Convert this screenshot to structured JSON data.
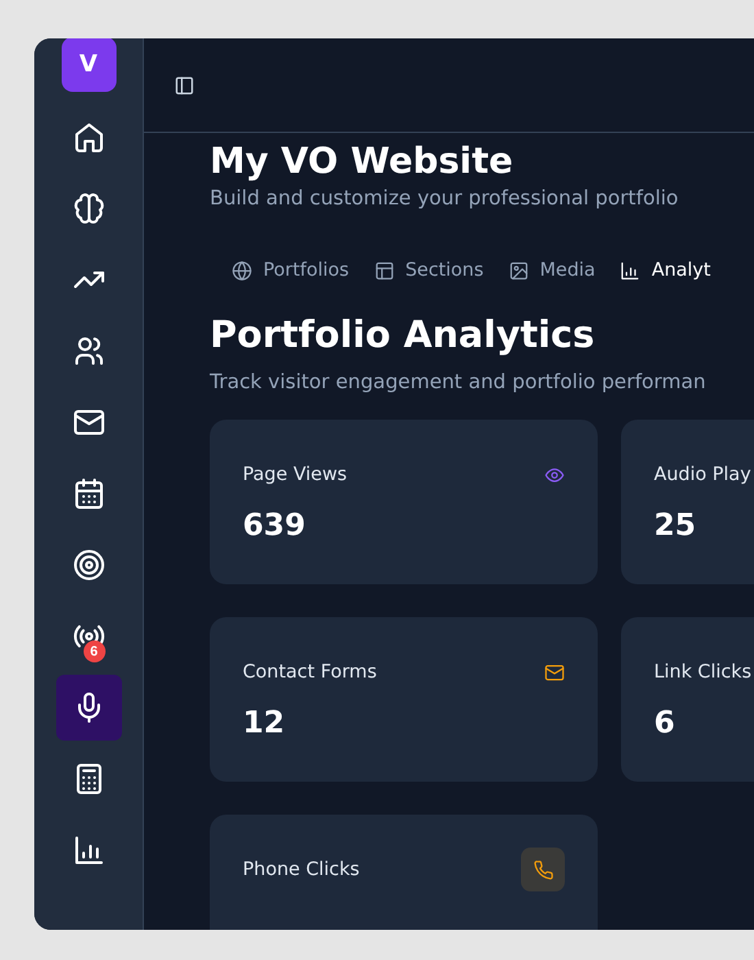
{
  "logo": {
    "letter": "V"
  },
  "sidebar": {
    "items": [
      {
        "selected": false
      },
      {
        "selected": false
      },
      {
        "selected": false
      },
      {
        "selected": false
      },
      {
        "selected": false
      },
      {
        "selected": false
      },
      {
        "selected": false
      },
      {
        "selected": false,
        "badge": "6"
      },
      {
        "selected": true
      },
      {
        "selected": false
      },
      {
        "selected": false
      }
    ]
  },
  "header": {
    "title": "My VO Website",
    "subtitle": "Build and customize your professional portfolio"
  },
  "tabs": [
    {
      "label": "Portfolios",
      "selected": false
    },
    {
      "label": "Sections",
      "selected": false
    },
    {
      "label": "Media",
      "selected": false
    },
    {
      "label": "Analyt",
      "selected": true
    }
  ],
  "section": {
    "title": "Portfolio Analytics",
    "subtitle": "Track visitor engagement and portfolio performan"
  },
  "cards": [
    {
      "label": "Page Views",
      "value": "639",
      "color": "#8b5cf6"
    },
    {
      "label": "Audio Play",
      "value": "25"
    },
    {
      "label": "Contact Forms",
      "value": "12",
      "color": "#f59e0b"
    },
    {
      "label": "Link Clicks",
      "value": "6"
    },
    {
      "label": "Phone Clicks",
      "color": "#f59e0b"
    }
  ]
}
